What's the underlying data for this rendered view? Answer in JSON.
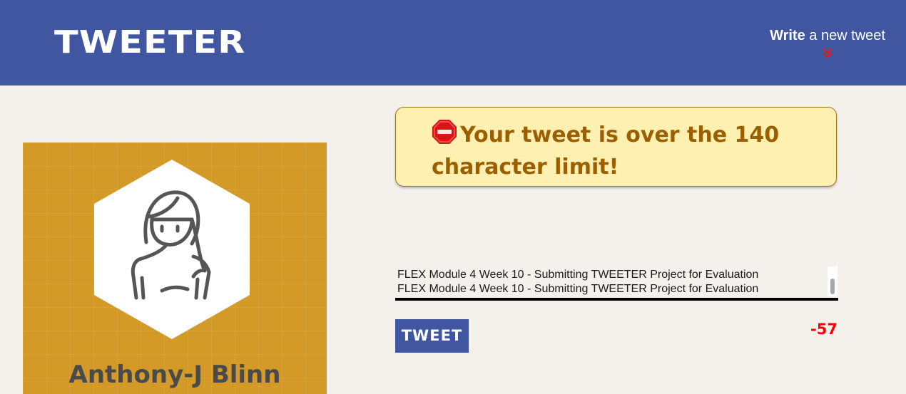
{
  "header": {
    "logo": "TWEETER",
    "write_bold": "Write",
    "write_rest": " a new tweet",
    "chevron_icon": "double-chevron-down-icon",
    "colors": {
      "navbar": "#4056a1",
      "chevron": "#d91e1e"
    }
  },
  "profile": {
    "name": "Anthony-J Blinn",
    "avatar_icon": "person-avatar-hexagon-icon",
    "colors": {
      "card": "#d39a28",
      "name": "#4a4a4a"
    }
  },
  "error": {
    "icon": "stop-sign-icon",
    "message": "Your tweet is over the 140 character limit!",
    "colors": {
      "background": "#fdf0b0",
      "text": "#9c5f00"
    }
  },
  "compose": {
    "lines": [
      "FLEX Module 4 Week 10 - Submitting TWEETER Project for Evaluation",
      "FLEX Module 4 Week 10 - Submitting TWEETER Project for Evaluation"
    ],
    "button_label": "TWEET",
    "counter": "-57",
    "colors": {
      "counter": "#ff0000",
      "button": "#4056a1"
    }
  }
}
